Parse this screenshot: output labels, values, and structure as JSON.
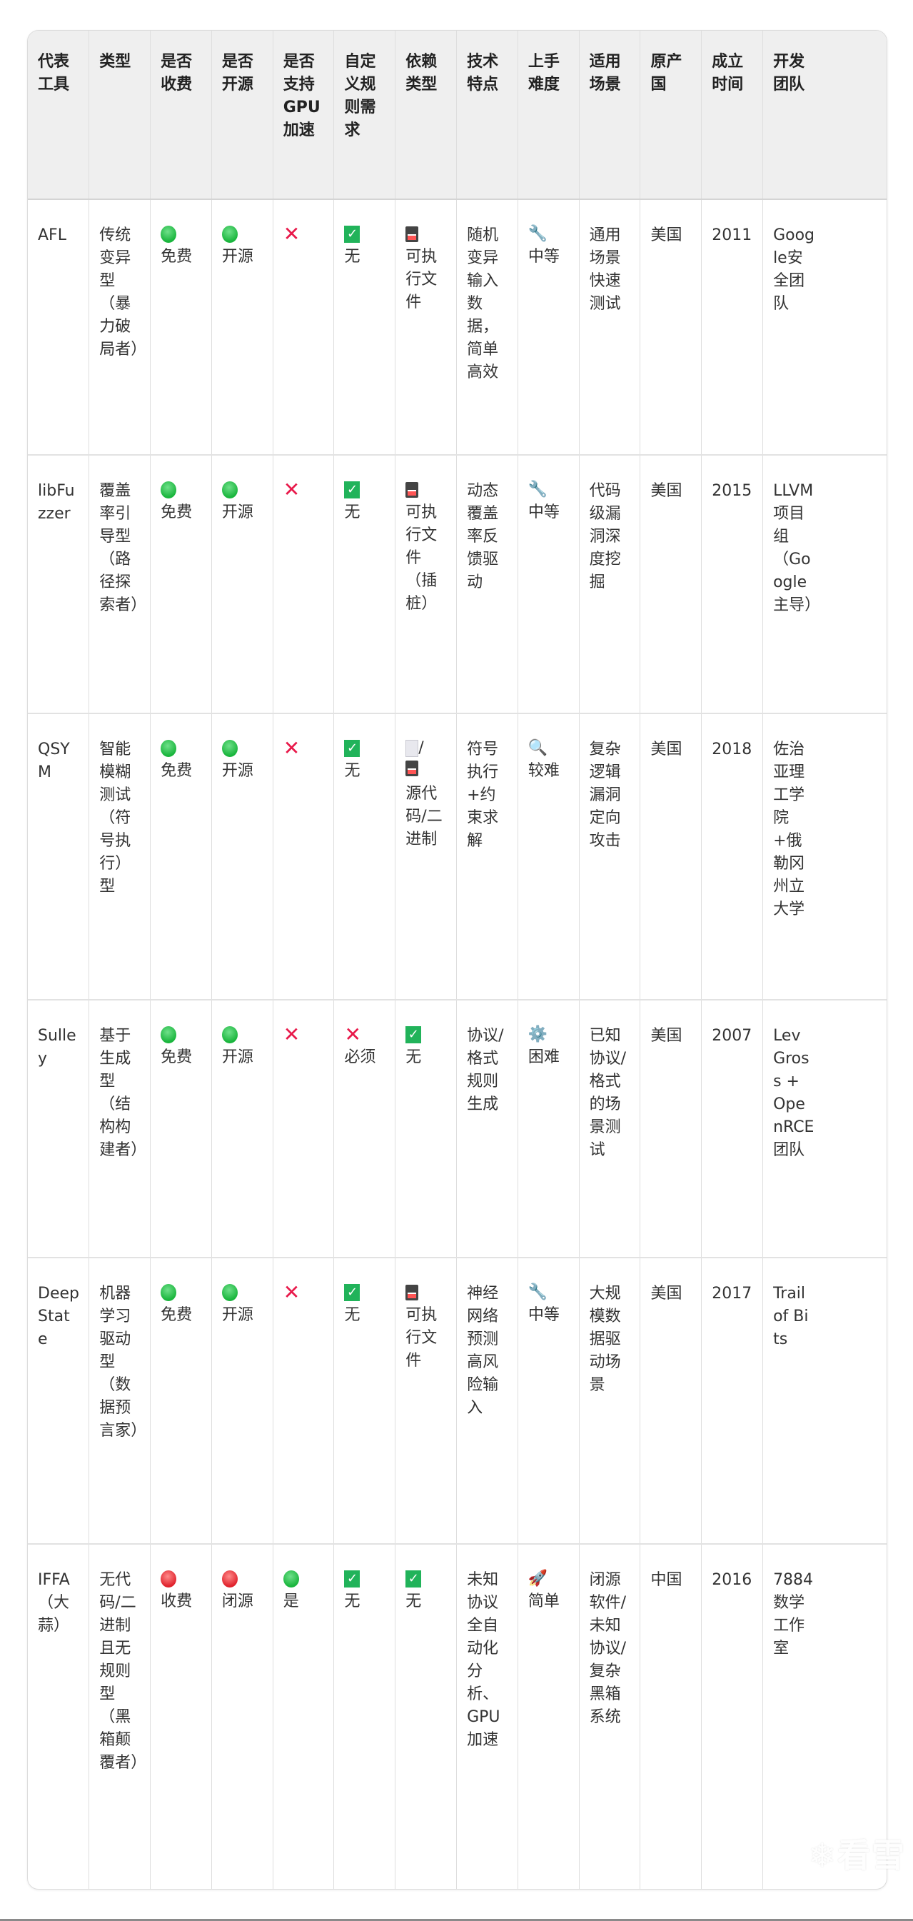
{
  "headers": [
    "代表工具",
    "类型",
    "是否收费",
    "是否开源",
    "是否支持GPU加速",
    "自定义规则需求",
    "依赖类型",
    "技术特点",
    "上手难度",
    "适用场景",
    "原产国",
    "成立时间",
    "开发团队"
  ],
  "rows": [
    {
      "tool": "AFL",
      "type": "传统变异型（暴力破局者）",
      "fee": {
        "icon": "green-circle",
        "label": "免费"
      },
      "open": {
        "icon": "green-circle",
        "label": "开源"
      },
      "gpu": {
        "icon": "red-x",
        "label": ""
      },
      "rules": {
        "icon": "green-check",
        "label": "无"
      },
      "dep": {
        "icon": "floppy",
        "label": "可执行文件"
      },
      "tech": "随机变异输入数据，简单高效",
      "difficulty": {
        "icon": "🔧",
        "label": "中等"
      },
      "scene": "通用场景快速测试",
      "country": "美国",
      "year": "2011",
      "team": "Google安全团队"
    },
    {
      "tool": "libFuzzer",
      "type": "覆盖率引导型（路径探索者）",
      "fee": {
        "icon": "green-circle",
        "label": "免费"
      },
      "open": {
        "icon": "green-circle",
        "label": "开源"
      },
      "gpu": {
        "icon": "red-x",
        "label": ""
      },
      "rules": {
        "icon": "green-check",
        "label": "无"
      },
      "dep": {
        "icon": "floppy",
        "label": "可执行文件（插桩）"
      },
      "tech": "动态覆盖率反馈驱动",
      "difficulty": {
        "icon": "🔧",
        "label": "中等"
      },
      "scene": "代码级漏洞深度挖掘",
      "country": "美国",
      "year": "2015",
      "team": "LLVM项目组（Google主导）"
    },
    {
      "tool": "QSYM",
      "type": "智能模糊测试（符号执行）型",
      "fee": {
        "icon": "green-circle",
        "label": "免费"
      },
      "open": {
        "icon": "green-circle",
        "label": "开源"
      },
      "gpu": {
        "icon": "red-x",
        "label": ""
      },
      "rules": {
        "icon": "green-check",
        "label": "无"
      },
      "dep": {
        "icon": "page-floppy",
        "label": "源代码/二进制"
      },
      "tech": "符号执行+约束求解",
      "difficulty": {
        "icon": "🔍",
        "label": "较难"
      },
      "scene": "复杂逻辑漏洞定向攻击",
      "country": "美国",
      "year": "2018",
      "team": "佐治亚理工学院+俄勒冈州立大学"
    },
    {
      "tool": "Sulley",
      "type": "基于生成型（结构构建者）",
      "fee": {
        "icon": "green-circle",
        "label": "免费"
      },
      "open": {
        "icon": "green-circle",
        "label": "开源"
      },
      "gpu": {
        "icon": "red-x",
        "label": ""
      },
      "rules": {
        "icon": "red-x",
        "label": "必须"
      },
      "dep": {
        "icon": "green-check",
        "label": "无"
      },
      "tech": "协议/格式规则生成",
      "difficulty": {
        "icon": "⚙️",
        "label": "困难"
      },
      "scene": "已知协议/格式的场景测试",
      "country": "美国",
      "year": "2007",
      "team": "Lev Gross + OpenRCE团队"
    },
    {
      "tool": "DeepState",
      "type": "机器学习驱动型（数据预言家）",
      "fee": {
        "icon": "green-circle",
        "label": "免费"
      },
      "open": {
        "icon": "green-circle",
        "label": "开源"
      },
      "gpu": {
        "icon": "red-x",
        "label": ""
      },
      "rules": {
        "icon": "green-check",
        "label": "无"
      },
      "dep": {
        "icon": "floppy",
        "label": "可执行文件"
      },
      "tech": "神经网络预测高风险输入",
      "difficulty": {
        "icon": "🔧",
        "label": "中等"
      },
      "scene": "大规模数据驱动场景",
      "country": "美国",
      "year": "2017",
      "team": "Trail of Bits"
    },
    {
      "tool": "IFFA（大蒜）",
      "type": "无代码/二进制且无规则型（黑箱颠覆者）",
      "fee": {
        "icon": "red-circle",
        "label": "收费"
      },
      "open": {
        "icon": "red-circle",
        "label": "闭源"
      },
      "gpu": {
        "icon": "green-circle",
        "label": "是"
      },
      "rules": {
        "icon": "green-check",
        "label": "无"
      },
      "dep": {
        "icon": "green-check",
        "label": "无"
      },
      "tech": "未知协议全自动化分析、GPU加速",
      "difficulty": {
        "icon": "🚀",
        "label": "简单"
      },
      "scene": "闭源软件/未知协议/复杂黑箱系统",
      "country": "中国",
      "year": "2016",
      "team": "7884数学工作室"
    }
  ],
  "watermark": "❄看雪"
}
